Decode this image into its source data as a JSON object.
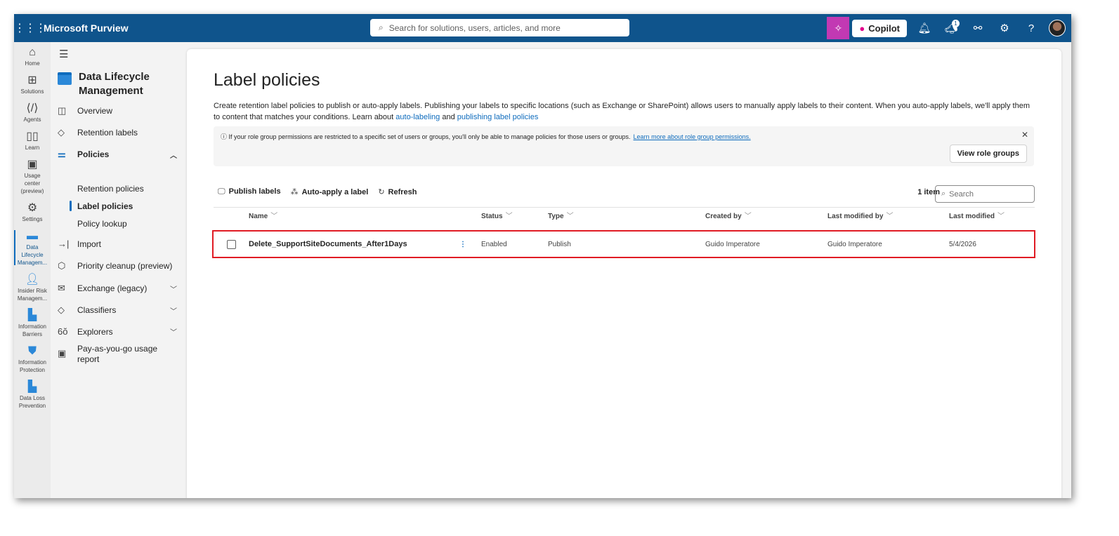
{
  "header": {
    "app_title": "Microsoft Purview",
    "search_placeholder": "Search for solutions, users, articles, and more",
    "copilot_label": "Copilot",
    "notification_badge": "1"
  },
  "rail": [
    {
      "label": "Home"
    },
    {
      "label": "Solutions"
    },
    {
      "label": "Agents"
    },
    {
      "label": "Learn"
    },
    {
      "label": "Usage center (preview)"
    },
    {
      "label": "Settings"
    },
    {
      "label": "Data Lifecycle Managem..."
    },
    {
      "label": "Insider Risk Managem..."
    },
    {
      "label": "Information Barriers"
    },
    {
      "label": "Information Protection"
    },
    {
      "label": "Data Loss Prevention"
    }
  ],
  "nav": {
    "title": "Data Lifecycle Management",
    "items": [
      "Overview",
      "Retention labels",
      "Policies",
      "Import",
      "Priority cleanup (preview)",
      "Exchange (legacy)",
      "Classifiers",
      "Explorers",
      "Pay-as-you-go usage report"
    ],
    "sub_items": [
      "Retention policies",
      "Label policies",
      "Policy lookup"
    ]
  },
  "page": {
    "title": "Label policies",
    "description": "Create retention label policies to publish or auto-apply labels. Publishing your labels to specific locations (such as Exchange or SharePoint) allows users to manually apply labels to their content. When you auto-apply labels, we'll apply them to content that matches your conditions. Learn about ",
    "link1": "auto-labeling",
    "and": " and ",
    "link2": "publishing label policies",
    "info_text": "If your role group permissions are restricted to a specific set of users or groups, you'll only be able to manage policies for those users or groups.",
    "info_link": "Learn more about role group permissions.",
    "view_role_groups": "View role groups"
  },
  "toolbar": {
    "publish": "Publish labels",
    "auto_apply": "Auto-apply a label",
    "refresh": "Refresh",
    "count": "1 item",
    "search_placeholder": "Search"
  },
  "table": {
    "columns": [
      "Name",
      "Status",
      "Type",
      "Created by",
      "Last modified by",
      "Last modified"
    ],
    "rows": [
      {
        "name": "Delete_SupportSiteDocuments_After1Days",
        "status": "Enabled",
        "type": "Publish",
        "created_by": "Guido Imperatore",
        "modified_by": "Guido Imperatore",
        "modified": "5/4/2026"
      }
    ]
  }
}
